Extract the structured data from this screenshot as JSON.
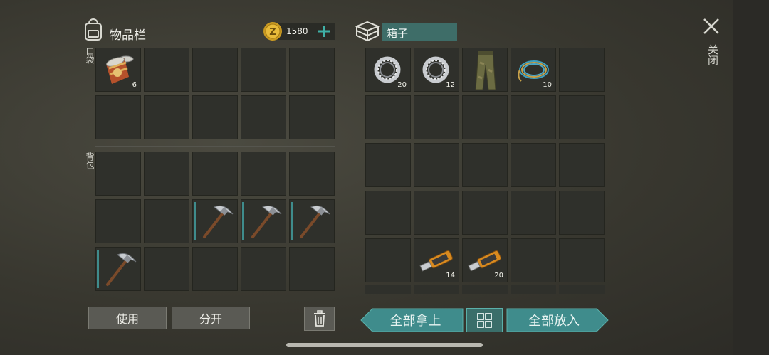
{
  "inventory": {
    "title": "物品栏",
    "coins": "1580",
    "pocket_label": "口袋",
    "backpack_label": "背包",
    "pocket_slots": [
      {
        "item": "tin-can",
        "count": "6"
      },
      {
        "item": "",
        "count": ""
      },
      {
        "item": "",
        "count": ""
      },
      {
        "item": "",
        "count": ""
      },
      {
        "item": "",
        "count": ""
      },
      {
        "item": "",
        "count": ""
      },
      {
        "item": "",
        "count": ""
      },
      {
        "item": "",
        "count": ""
      },
      {
        "item": "",
        "count": ""
      },
      {
        "item": "",
        "count": ""
      }
    ],
    "backpack_slots": [
      {
        "item": "",
        "count": ""
      },
      {
        "item": "",
        "count": ""
      },
      {
        "item": "",
        "count": ""
      },
      {
        "item": "",
        "count": ""
      },
      {
        "item": "",
        "count": ""
      },
      {
        "item": "",
        "count": ""
      },
      {
        "item": "",
        "count": ""
      },
      {
        "item": "pickaxe",
        "count": ""
      },
      {
        "item": "pickaxe",
        "count": ""
      },
      {
        "item": "pickaxe",
        "count": ""
      },
      {
        "item": "pickaxe",
        "count": ""
      },
      {
        "item": "",
        "count": ""
      },
      {
        "item": "",
        "count": ""
      },
      {
        "item": "",
        "count": ""
      },
      {
        "item": "",
        "count": ""
      }
    ],
    "use_label": "使用",
    "split_label": "分开"
  },
  "box": {
    "title": "箱子",
    "slots": [
      {
        "item": "bearing",
        "count": "20"
      },
      {
        "item": "bearing",
        "count": "12"
      },
      {
        "item": "pants",
        "count": ""
      },
      {
        "item": "cable",
        "count": "10"
      },
      {
        "item": "",
        "count": ""
      },
      {
        "item": "",
        "count": ""
      },
      {
        "item": "",
        "count": ""
      },
      {
        "item": "",
        "count": ""
      },
      {
        "item": "",
        "count": ""
      },
      {
        "item": "",
        "count": ""
      },
      {
        "item": "",
        "count": ""
      },
      {
        "item": "",
        "count": ""
      },
      {
        "item": "",
        "count": ""
      },
      {
        "item": "",
        "count": ""
      },
      {
        "item": "",
        "count": ""
      },
      {
        "item": "",
        "count": ""
      },
      {
        "item": "",
        "count": ""
      },
      {
        "item": "",
        "count": ""
      },
      {
        "item": "",
        "count": ""
      },
      {
        "item": "",
        "count": ""
      },
      {
        "item": "",
        "count": ""
      },
      {
        "item": "usb-drive",
        "count": "14"
      },
      {
        "item": "usb-drive",
        "count": "20"
      },
      {
        "item": "",
        "count": ""
      },
      {
        "item": "",
        "count": ""
      }
    ],
    "take_all_label": "全部拿上",
    "put_all_label": "全部放入"
  },
  "close_label": "关闭",
  "colors": {
    "accent": "#3f8c8c",
    "slot": "#2f302b",
    "button": "#5a5a54"
  }
}
